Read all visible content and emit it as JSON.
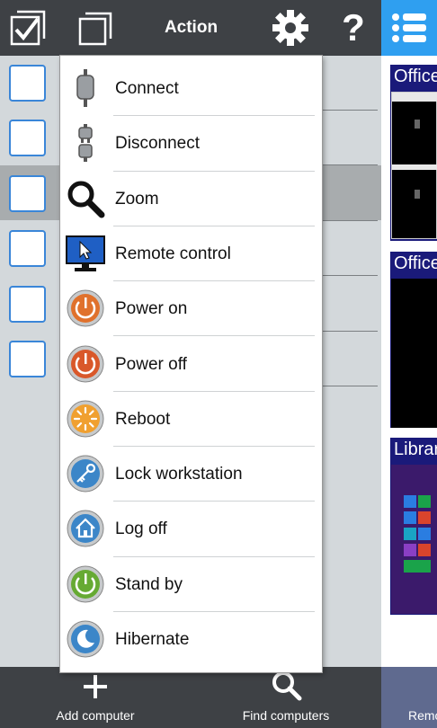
{
  "toolbar": {
    "title": "Action",
    "help_glyph": "?",
    "icons": [
      "select-all-icon",
      "copy-icon",
      "gear-icon",
      "help-icon",
      "list-icon"
    ]
  },
  "menu": {
    "items": [
      {
        "label": "Connect",
        "icon": "connect-plug-icon"
      },
      {
        "label": "Disconnect",
        "icon": "disconnect-plug-icon"
      },
      {
        "label": "Zoom",
        "icon": "zoom-icon"
      },
      {
        "label": "Remote control",
        "icon": "remote-control-monitor-icon"
      },
      {
        "label": "Power on",
        "icon": "power-on-icon"
      },
      {
        "label": "Power off",
        "icon": "power-off-icon"
      },
      {
        "label": "Reboot",
        "icon": "reboot-icon"
      },
      {
        "label": "Lock workstation",
        "icon": "lock-workstation-icon"
      },
      {
        "label": "Log off",
        "icon": "log-off-icon"
      },
      {
        "label": "Stand by",
        "icon": "stand-by-icon"
      },
      {
        "label": "Hibernate",
        "icon": "hibernate-icon"
      }
    ]
  },
  "thumbnails": [
    {
      "title": "Office"
    },
    {
      "title": "Office"
    },
    {
      "title": "Librar"
    }
  ],
  "bottom": {
    "add_label": "Add computer",
    "find_label": "Find computers",
    "remote_label": "Remo"
  },
  "colors": {
    "bar": "#3e4145",
    "accent": "#2f9ff0",
    "checkbox_border": "#3a86d8",
    "highlight_row": "#a8acae",
    "power_on": "#e0712c",
    "reboot": "#f0a030",
    "lock": "#3c86c8",
    "stand_by": "#66aa33"
  }
}
